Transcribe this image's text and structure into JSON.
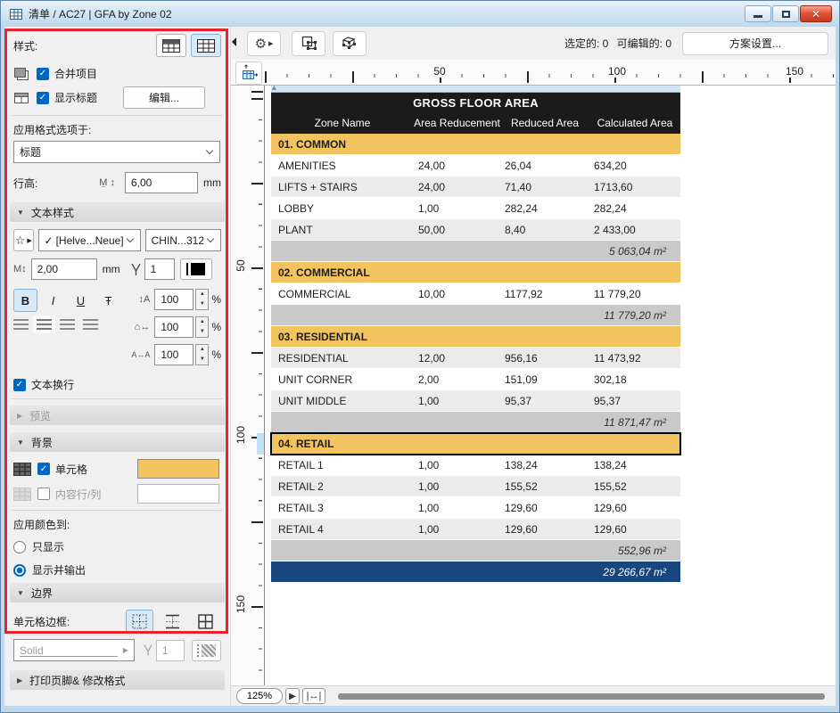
{
  "window": {
    "title": "清单 / AC27 | GFA by Zone 02"
  },
  "panel": {
    "style_label": "样式:",
    "merge_label": "合并项目",
    "show_header_label": "显示标题",
    "edit_button": "编辑...",
    "apply_format_label": "应用格式选项于:",
    "format_target": "标题",
    "row_height_label": "行高:",
    "row_height_value": "6,00",
    "row_height_unit": "mm",
    "text_style": {
      "header": "文本样式",
      "font_check": "✓",
      "font_name": "[Helve...Neue]",
      "encoding": "CHIN...312",
      "size_value": "2,00",
      "size_unit": "mm",
      "pen_value": "1",
      "bold": "B",
      "italic": "I",
      "underline": "U",
      "strike": "Ŧ",
      "spacing_values": [
        "100",
        "100",
        "100"
      ],
      "spacing_unit": "%",
      "wrap_label": "文本换行"
    },
    "preview_header": "预览",
    "background": {
      "header": "背景",
      "cells_label": "单元格",
      "rows_label": "内容行/列",
      "cell_color": "#f3c35f",
      "row_color": "#ffffff"
    },
    "apply_color_label": "应用颜色到:",
    "radio_display_only": "只显示",
    "radio_display_output": "显示并输出",
    "border": {
      "header": "边界",
      "cell_border_label": "单元格边框:",
      "line_type": "Solid",
      "pen_value": "1"
    },
    "footer_header": "打印页脚& 修改格式"
  },
  "toolbar": {
    "selected_label": "选定的: 0",
    "editable_label": "可编辑的: 0",
    "scheme_button": "方案设置..."
  },
  "rulers": {
    "h": [
      "50",
      "100",
      "150"
    ],
    "v": [
      "50",
      "100",
      "150"
    ]
  },
  "table": {
    "title": "GROSS FLOOR AREA",
    "columns": [
      "Zone Name",
      "Area Reducement",
      "Reduced Area",
      "Calculated Area"
    ],
    "colors": {
      "group_bg": "#f3c35f",
      "alt_bg": "#ebebeb",
      "summary_bg": "#c9c9c9",
      "total_bg": "#17477e",
      "header_bg": "#1b1b1b"
    },
    "rows": [
      {
        "type": "group",
        "name": "01. COMMON"
      },
      {
        "type": "data",
        "shade": "white",
        "name": "AMENITIES",
        "values": [
          "24,00",
          "26,04",
          "634,20"
        ]
      },
      {
        "type": "data",
        "shade": "gray",
        "name": "LIFTS + STAIRS",
        "values": [
          "24,00",
          "71,40",
          "1713,60"
        ]
      },
      {
        "type": "data",
        "shade": "white",
        "name": "LOBBY",
        "values": [
          "1,00",
          "282,24",
          "282,24"
        ]
      },
      {
        "type": "data",
        "shade": "gray",
        "name": "PLANT",
        "values": [
          "50,00",
          "8,40",
          "2 433,00"
        ]
      },
      {
        "type": "summary",
        "total": "5 063,04 m²"
      },
      {
        "type": "group",
        "name": "02. COMMERCIAL"
      },
      {
        "type": "data",
        "shade": "white",
        "name": "COMMERCIAL",
        "values": [
          "10,00",
          "1177,92",
          "11 779,20"
        ]
      },
      {
        "type": "summary",
        "total": "11 779,20 m²"
      },
      {
        "type": "group",
        "name": "03. RESIDENTIAL"
      },
      {
        "type": "data",
        "shade": "gray",
        "name": "RESIDENTIAL",
        "values": [
          "12,00",
          "956,16",
          "11 473,92"
        ]
      },
      {
        "type": "data",
        "shade": "white",
        "name": "UNIT CORNER",
        "values": [
          "2,00",
          "151,09",
          "302,18"
        ]
      },
      {
        "type": "data",
        "shade": "gray",
        "name": "UNIT MIDDLE",
        "values": [
          "1,00",
          "95,37",
          "95,37"
        ]
      },
      {
        "type": "summary",
        "total": "11 871,47 m²"
      },
      {
        "type": "group",
        "name": "04. RETAIL",
        "selected": true
      },
      {
        "type": "data",
        "shade": "white",
        "name": "RETAIL 1",
        "values": [
          "1,00",
          "138,24",
          "138,24"
        ]
      },
      {
        "type": "data",
        "shade": "gray",
        "name": "RETAIL 2",
        "values": [
          "1,00",
          "155,52",
          "155,52"
        ]
      },
      {
        "type": "data",
        "shade": "white",
        "name": "RETAIL 3",
        "values": [
          "1,00",
          "129,60",
          "129,60"
        ]
      },
      {
        "type": "data",
        "shade": "gray",
        "name": "RETAIL 4",
        "values": [
          "1,00",
          "129,60",
          "129,60"
        ]
      },
      {
        "type": "summary",
        "total": "552,96 m²"
      },
      {
        "type": "total",
        "total": "29 266,67 m²"
      }
    ]
  },
  "bottombar": {
    "zoom": "125%"
  }
}
